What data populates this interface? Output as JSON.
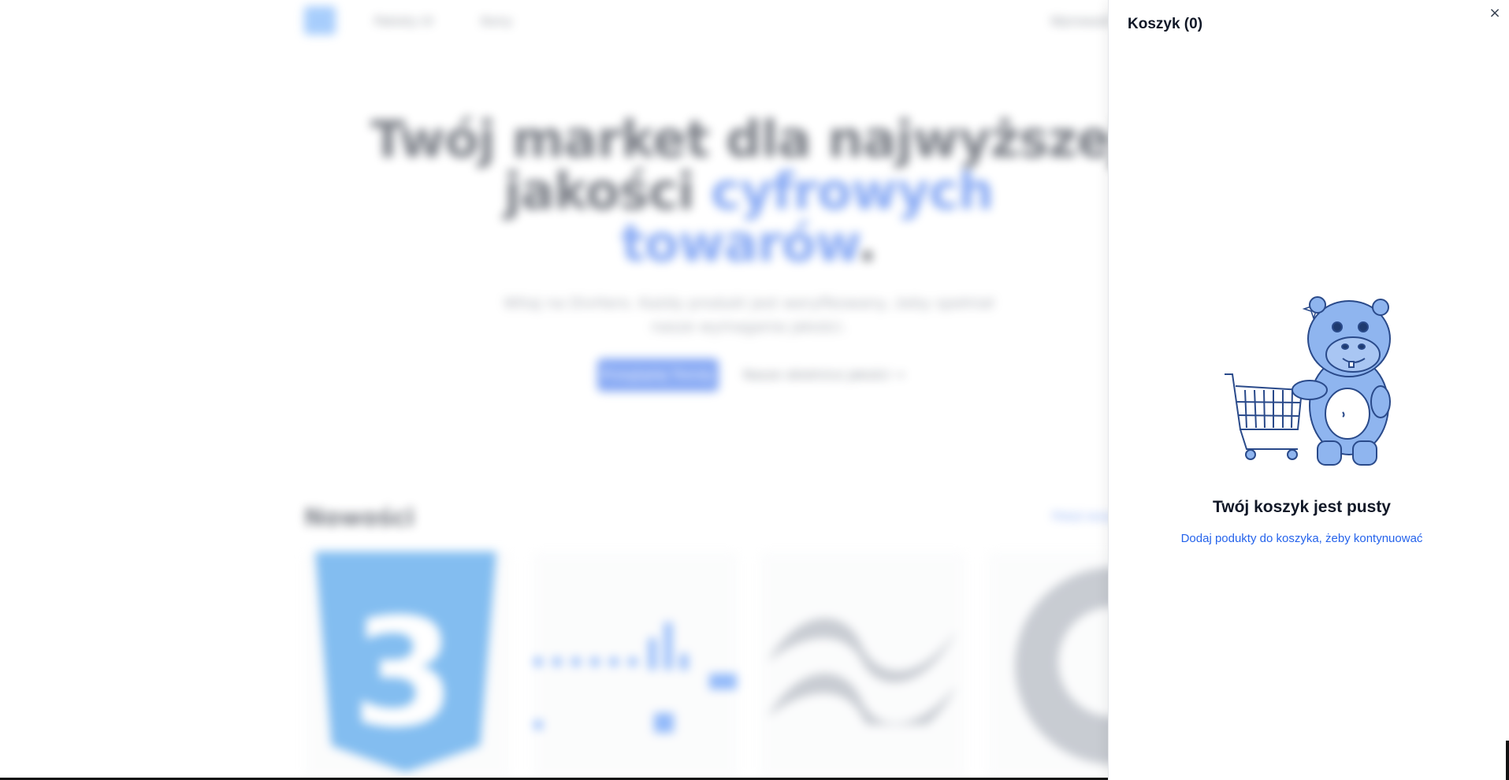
{
  "background": {
    "nav": {
      "items": [
        "Pakiety UI",
        "Ikony"
      ],
      "right_link": "Wprowadź"
    },
    "hero": {
      "title_line1": "Twój market dla najwyższej",
      "title_line2_plain": "jakości ",
      "title_line2_accent": "cyfrowych",
      "title_line3_accent": "towarów",
      "title_period": ".",
      "subtitle": "Witaj na DivHero. Każdy produkt jest weryfikowany, żeby spełniał nasze wymagania jakości.",
      "primary_button": "Przeglądaj Trendy",
      "secondary_link": "Nasze obietnice jakości →"
    },
    "section": {
      "title": "Nowości",
      "link": "Pokaż wszystkie"
    },
    "cards": [
      "css3",
      "ui-kit",
      "tailwind",
      "github"
    ]
  },
  "cart": {
    "title": "Koszyk (0)",
    "close_glyph": "×",
    "empty_title": "Twój koszyk jest pusty",
    "empty_link": "Dodaj podukty do koszyka, żeby kontynuować"
  },
  "colors": {
    "accent": "#2563eb",
    "hippo_fill": "#8fb5ef",
    "hippo_stroke": "#2a4a8a"
  }
}
